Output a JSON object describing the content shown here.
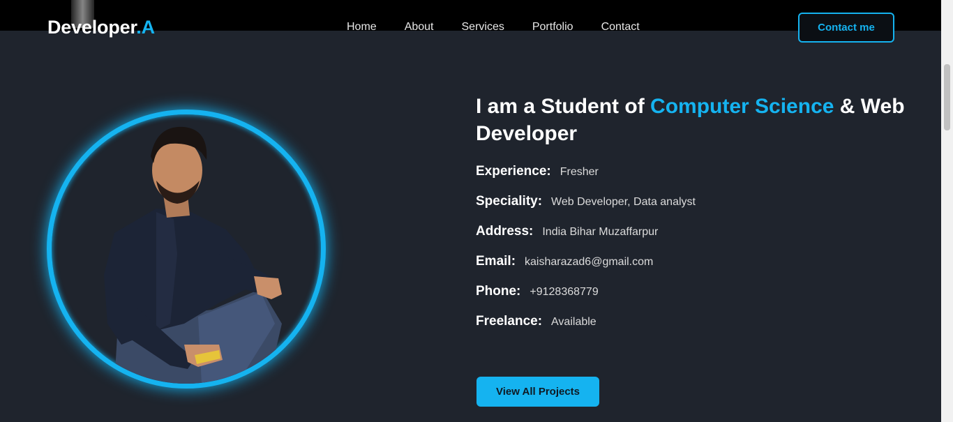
{
  "brand": {
    "name": "Developer",
    "suffix": ".A"
  },
  "nav": {
    "items": [
      "Home",
      "About",
      "Services",
      "Portfolio",
      "Contact"
    ]
  },
  "header": {
    "cta_label": "Contact me"
  },
  "about": {
    "headline_pre": "I am a Student of ",
    "headline_highlight": "Computer Science",
    "headline_post": " & Web Developer",
    "details": [
      {
        "label": "Experience:",
        "value": "Fresher"
      },
      {
        "label": "Speciality:",
        "value": "Web Developer, Data analyst"
      },
      {
        "label": "Address:",
        "value": "India Bihar Muzaffarpur"
      },
      {
        "label": "Email:",
        "value": "kaisharazad6@gmail.com"
      },
      {
        "label": "Phone:",
        "value": "+9128368779"
      },
      {
        "label": "Freelance:",
        "value": "Available"
      }
    ],
    "cta_label": "View All Projects"
  },
  "colors": {
    "accent": "#15b3f0",
    "background": "#1f242d",
    "header": "#000000"
  }
}
